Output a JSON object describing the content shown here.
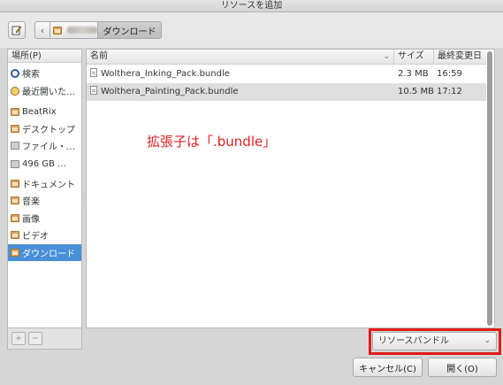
{
  "window": {
    "title": "リソースを追加"
  },
  "toolbar": {
    "path_current": "ダウンロード"
  },
  "sidebar": {
    "header": "場所(P)",
    "items": [
      {
        "label": "検索",
        "icon": "search-icon"
      },
      {
        "label": "最近開いた…",
        "icon": "recent-icon"
      },
      {
        "label": "BeatRix",
        "icon": "folder-icon"
      },
      {
        "label": "デスクトップ",
        "icon": "folder-icon"
      },
      {
        "label": "ファイル・…",
        "icon": "drive-icon"
      },
      {
        "label": "496 GB …",
        "icon": "drive-icon"
      },
      {
        "label": "ドキュメント",
        "icon": "folder-icon"
      },
      {
        "label": "音楽",
        "icon": "folder-icon"
      },
      {
        "label": "画像",
        "icon": "folder-icon"
      },
      {
        "label": "ビデオ",
        "icon": "folder-icon"
      },
      {
        "label": "ダウンロード",
        "icon": "folder-icon",
        "selected": true
      }
    ],
    "add_label": "+",
    "remove_label": "−"
  },
  "filelist": {
    "columns": {
      "name": "名前",
      "size": "サイズ",
      "modified": "最終変更日"
    },
    "rows": [
      {
        "name": "Wolthera_Inking_Pack.bundle",
        "size": "2.3 MB",
        "modified": "16:59"
      },
      {
        "name": "Wolthera_Painting_Pack.bundle",
        "size": "10.5 MB",
        "modified": "17:12"
      }
    ]
  },
  "annotation": "拡張子は「.bundle」",
  "filter": {
    "selected": "リソースバンドル"
  },
  "buttons": {
    "cancel": "キャンセル(C)",
    "open": "開く(O)"
  },
  "colors": {
    "selection": "#4a90d9",
    "annotation": "#e02020",
    "highlight_box": "#e21b1b"
  }
}
